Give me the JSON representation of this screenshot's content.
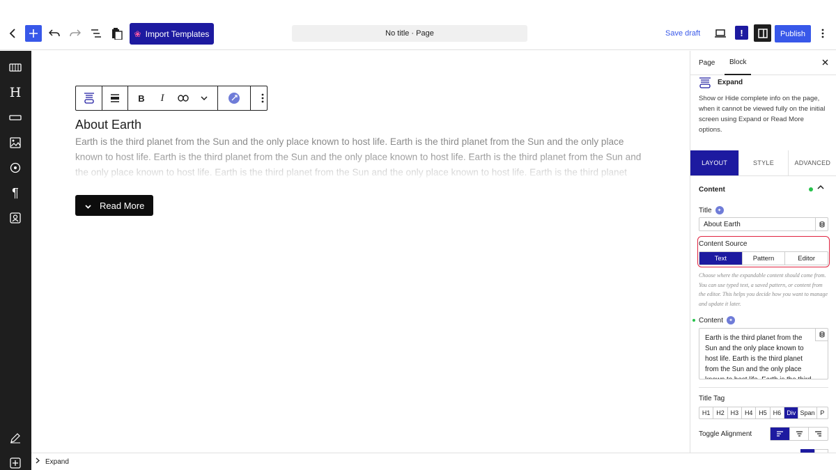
{
  "topbar": {
    "import_templates": "Import Templates",
    "document_title": "No title · Page",
    "save_draft": "Save draft",
    "publish": "Publish"
  },
  "canvas": {
    "expand_title": "About Earth",
    "expand_text": "Earth is the third planet from the Sun and the only place known to host life. Earth is the third planet from the Sun and the only place known to host life. Earth is the third planet from the Sun and the only place known to host life. Earth is the third planet from the Sun and the only place known to host life. Earth is the third planet from the Sun and the only place known to host life. Earth is the third planet from the Sun and the only place known to host life.",
    "read_more": "Read More",
    "toolbar_bold": "B",
    "toolbar_italic": "I"
  },
  "footer": {
    "breadcrumb": "Expand"
  },
  "sidebar": {
    "tabs": [
      "Page",
      "Block"
    ],
    "block_name": "Expand",
    "block_description": "Show or Hide complete info on the page, when it cannot be viewed fully on the initial screen using Expand or Read More options.",
    "panel_tabs": [
      "LAYOUT",
      "STYLE",
      "ADVANCED"
    ],
    "section_title": "Content",
    "title_label": "Title",
    "title_value": "About Earth",
    "content_source_label": "Content Source",
    "content_source_options": [
      "Text",
      "Pattern",
      "Editor"
    ],
    "content_source_selected": "Text",
    "content_source_help": "Choose where the expandable content should come from. You can use typed text, a saved pattern, or content from the editor. This helps you decide how you want to manage and update it later.",
    "content_label": "Content",
    "content_value": "Earth is the third planet from the Sun and the only place known to host life. Earth is the third planet from the Sun and the only place known to host life. Earth is the third planet from the Sun and the only place known to host life.",
    "title_tag_label": "Title Tag",
    "title_tags": [
      "H1",
      "H2",
      "H3",
      "H4",
      "H5",
      "H6",
      "Div",
      "Span",
      "P"
    ],
    "title_tag_selected": "Div",
    "toggle_alignment_label": "Toggle Alignment",
    "toggle_alignment_selected": "left"
  },
  "colors": {
    "accent_blue": "#3858e9",
    "brand_navy": "#1d1aa0",
    "highlight_red": "#e0223f",
    "status_green": "#27c24c"
  }
}
